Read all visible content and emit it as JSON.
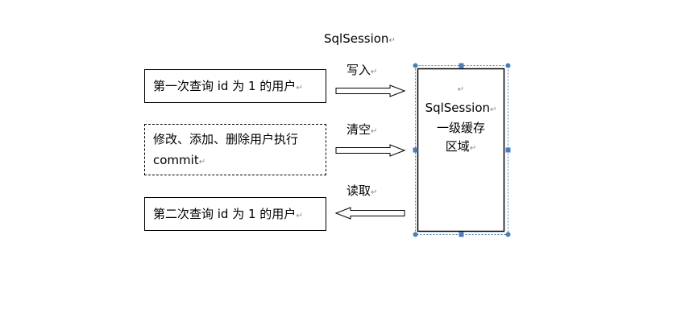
{
  "title": "SqlSession",
  "para_mark": "↵",
  "steps": [
    {
      "box_text": "第一次查询 id 为 1 的用户",
      "arrow_label": "写入",
      "direction": "to-cache",
      "border": "solid"
    },
    {
      "box_text_line1": "修改、添加、删除用户执行",
      "box_text_line2": "commit",
      "arrow_label": "清空",
      "direction": "to-cache",
      "border": "dashed"
    },
    {
      "box_text": "第二次查询 id 为 1 的用户",
      "arrow_label": "读取",
      "direction": "from-cache",
      "border": "solid"
    }
  ],
  "cache": {
    "line1": "SqlSession",
    "line2": "一级缓存",
    "line3": "区域"
  },
  "colors": {
    "selection": "#4a7ebb",
    "handle_fill": "#4a7ebb",
    "stroke": "#000000"
  }
}
